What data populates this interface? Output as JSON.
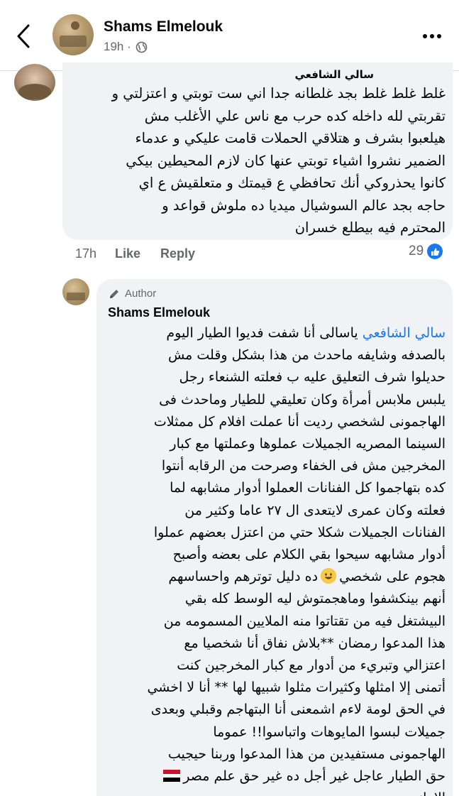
{
  "header": {
    "name": "Shams Elmelouk",
    "time": "19h ·"
  },
  "comment1": {
    "author": "سالي الشافعي",
    "lines": [
      "غلط غلط غلط بجد غلطانه جدا اني ست توبتي و اعتزلتي و",
      "تقربتي لله داخله كده حرب مع ناس علي الأغلب مش",
      "هيلعبوا بشرف و هتلاقي الحملات قامت عليكي و عدماء",
      "الضمير نشروا اشياء توبتي عنها كان لازم  المحيطين بيكي",
      "كانوا يحذروكي أنك تحافظي ع قيمتك و متعلقيش ع اي",
      "حاجه بجد عالم السوشيال ميديا ده ملوش قواعد و",
      "المحترم فيه بيطلع خسران"
    ],
    "time": "17h",
    "like": "Like",
    "reply": "Reply",
    "reactions": "29"
  },
  "comment2": {
    "badge": "Author",
    "author": "Shams Elmelouk",
    "mention": "سالي الشافعي",
    "first_line_rest": " ياسالى أنا شفت فديوا الطيار اليوم",
    "lines": [
      "بالصدفه وشايفه ماحدث من هذا بشكل وقلت مش",
      "حديلوا شرف التعليق عليه ب فعلته الشنعاء رجل",
      "يلبس ملابس أمرأة وكان تعليقي للطيار وماحدث فى",
      "الهاجمونى لشخصي رديت أنا عملت افلام كل ممثلات",
      "السينما المصريه الجميلات عملوها وعملتها مع كبار",
      "المخرجين مش فى الخفاء وصرحت من الرقابه أنتوا",
      "كده بتهاجموا كل الفنانات العملوا أدوار مشابهه لما",
      "فعلته وكان عمرى لايتعدى ال ٢٧ عاما وكثير من",
      "الفنانات الجميلات شكلا حتي من اعتزل بعضهم عملوا",
      "أدوار مشابهه سيحوا بقي الكلام على بعضه وأصبح"
    ],
    "smiley_line_a": "هجوم على شخصي",
    "smiley_line_b": "ده دليل توترهم واحساسهم",
    "lines2": [
      "أنهم بينكشفوا وماهجمتوش ليه الوسط كله بقي",
      "البيشتغل فيه من تقتاتوا منه الملايين المسمومه من",
      "هذا المدعوا رمضان **بلاش نفاق أنا شخصيا مع",
      "اعتزالي وتبريء من أدوار مع كبار المخرجين كنت",
      "أتمنى إلا امثلها وكثيرات مثلوا شبيها لها ** أنا لا اخشي",
      "في الحق لومة لاءم اشمعنى أنا البتهاجم وقبلي وبعدى",
      "جميلات لبسوا المايوهات واتباسوا!!  عموما",
      "الهاجمونى مستفيدين من هذا المدعوا وربنا حيجيب"
    ],
    "flag_line": "حق الطيار عاجل غير أجل ده غير حق علم مصر",
    "last_line": "الاهانه"
  },
  "colors": {
    "accent": "#1877f2",
    "bubble": "#f0f2f5",
    "muted": "#65676b"
  },
  "icons": [
    "back-arrow-icon",
    "globe-icon",
    "more-horizontal-icon",
    "like-icon",
    "pencil-icon",
    "smiley-emoji-icon",
    "egypt-flag-emoji-icon"
  ]
}
